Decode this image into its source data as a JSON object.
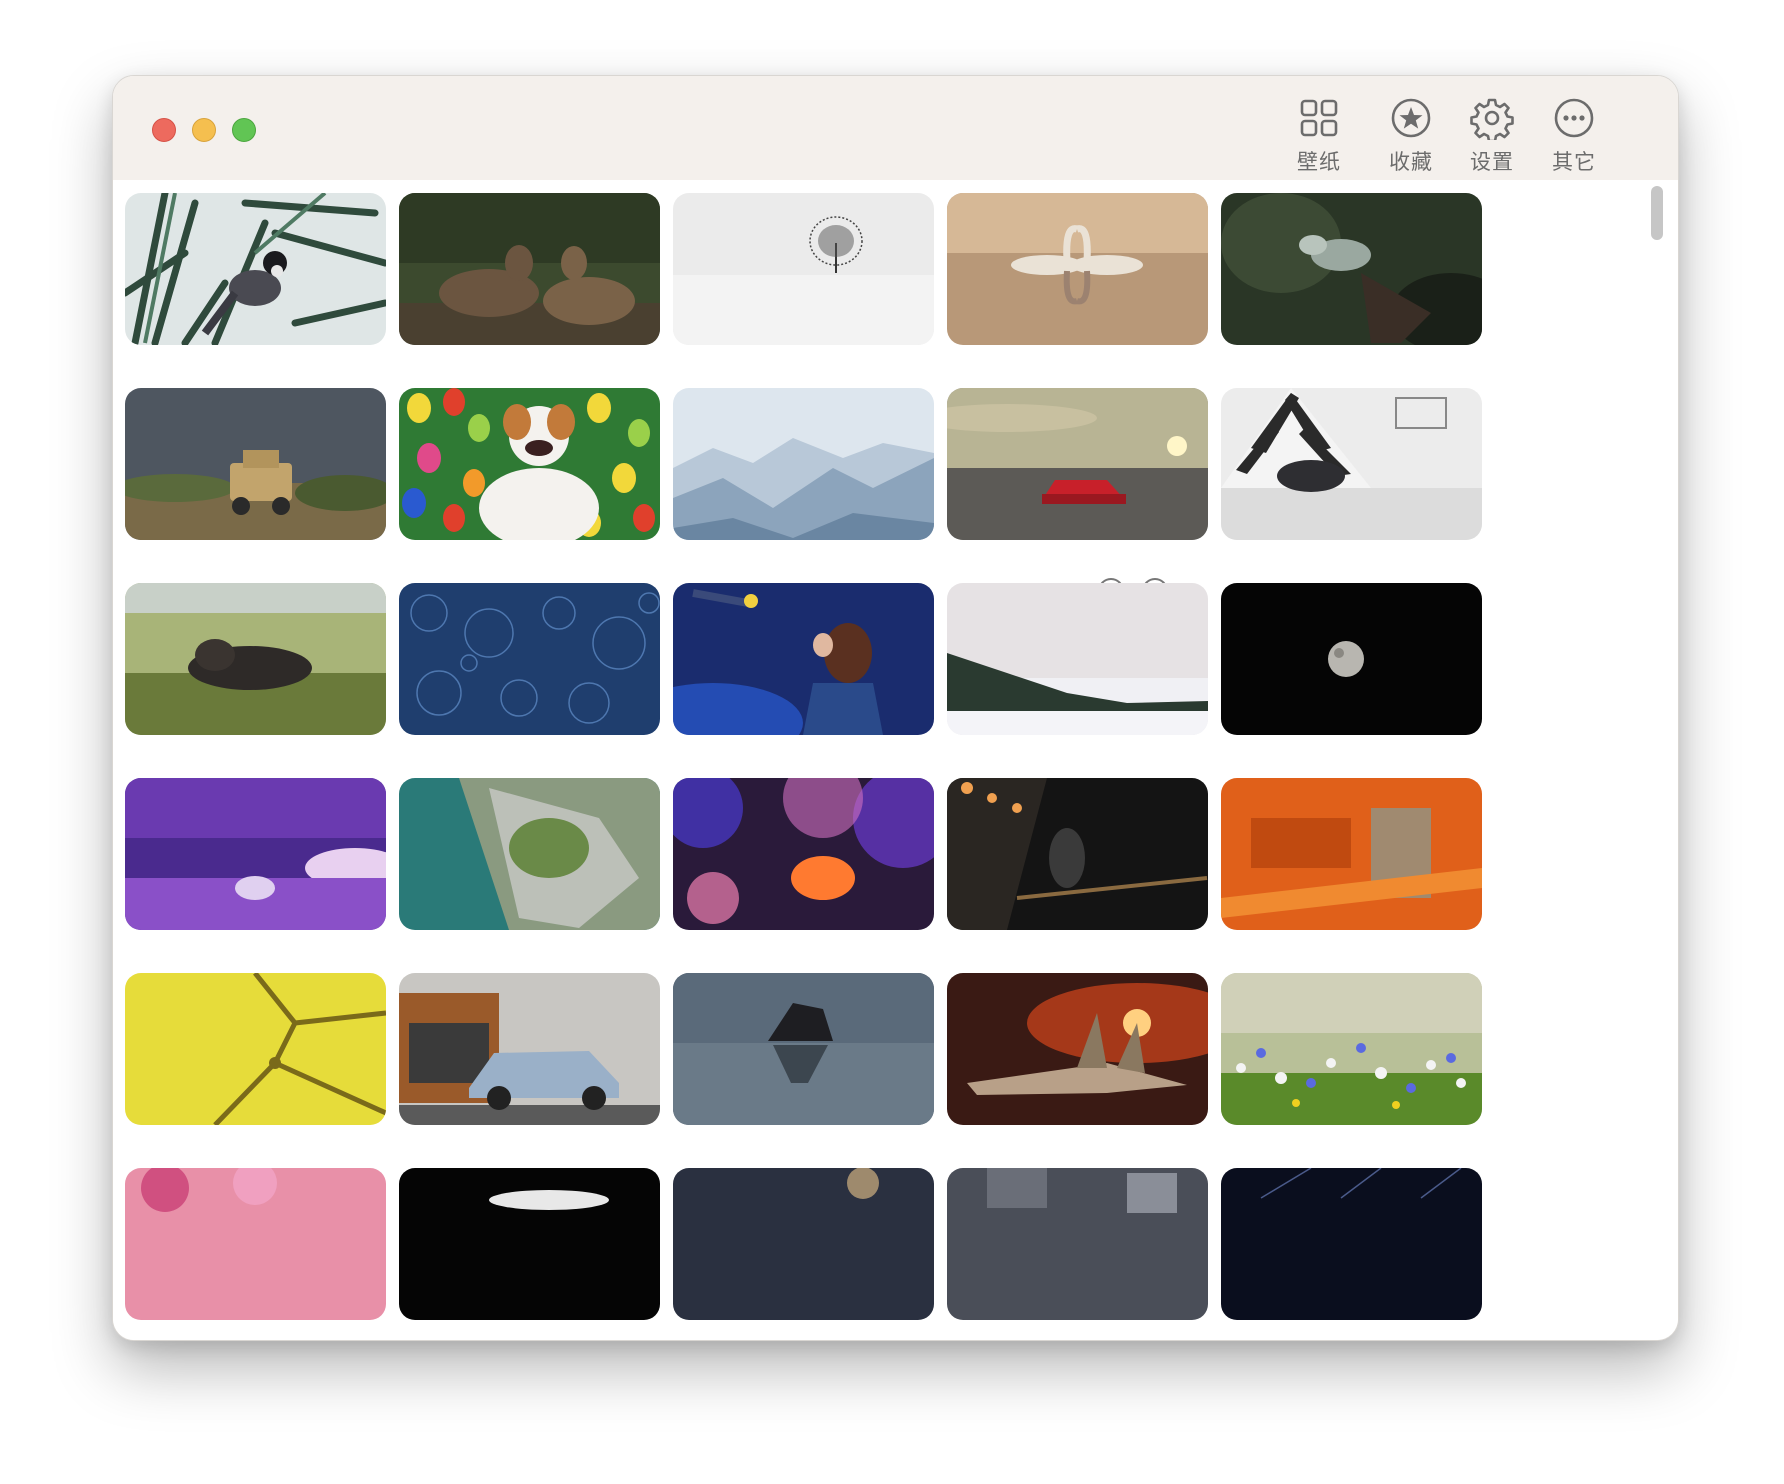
{
  "toolbar": {
    "wallpaper_label": "壁纸",
    "favorites_label": "收藏",
    "settings_label": "设置",
    "other_label": "其它"
  },
  "wallpapers": [
    {
      "subject": "bird",
      "icon": "bird-photo"
    },
    {
      "subject": "deer",
      "icon": "deer-photo"
    },
    {
      "subject": "tree",
      "icon": "tree-photo"
    },
    {
      "subject": "swans",
      "icon": "swans-photo"
    },
    {
      "subject": "iguana",
      "icon": "iguana-photo"
    },
    {
      "subject": "armored-vehicle",
      "icon": "vehicle-photo"
    },
    {
      "subject": "dog-eggs",
      "icon": "dog-photo"
    },
    {
      "subject": "mountains",
      "icon": "mountains-photo"
    },
    {
      "subject": "red-car",
      "icon": "car-photo"
    },
    {
      "subject": "dog-tent",
      "icon": "dog-tent-photo"
    },
    {
      "subject": "seal",
      "icon": "seal-photo"
    },
    {
      "subject": "water-drops",
      "icon": "drops-photo"
    },
    {
      "subject": "girl-night",
      "icon": "girl-photo"
    },
    {
      "subject": "snow-forest",
      "icon": "snow-photo"
    },
    {
      "subject": "moon",
      "icon": "moon-photo"
    },
    {
      "subject": "purple-sky",
      "icon": "sky-photo"
    },
    {
      "subject": "aerial-coast",
      "icon": "coast-photo"
    },
    {
      "subject": "bokeh",
      "icon": "bokeh-photo"
    },
    {
      "subject": "anime-girl",
      "icon": "anime-photo"
    },
    {
      "subject": "orange-paint",
      "icon": "paint-photo"
    },
    {
      "subject": "yellow-cells",
      "icon": "cells-photo"
    },
    {
      "subject": "suv",
      "icon": "suv-photo"
    },
    {
      "subject": "sea-rock",
      "icon": "rock-photo"
    },
    {
      "subject": "jet-sunset",
      "icon": "jet-photo"
    },
    {
      "subject": "flowers",
      "icon": "flowers-photo"
    },
    {
      "subject": "pink-flowers",
      "icon": "pink-photo"
    },
    {
      "subject": "black",
      "icon": "dark-photo"
    },
    {
      "subject": "blur",
      "icon": "blur-photo"
    },
    {
      "subject": "city",
      "icon": "city-photo"
    },
    {
      "subject": "star-trails",
      "icon": "stars-photo"
    }
  ],
  "hover_actions": {
    "preview_icon": "eye-icon",
    "apply_icon": "arrow-right-circle-icon"
  },
  "colors": {
    "titlebar_bg": "#f4f0ec",
    "icon_gray": "#6c6c6c"
  }
}
